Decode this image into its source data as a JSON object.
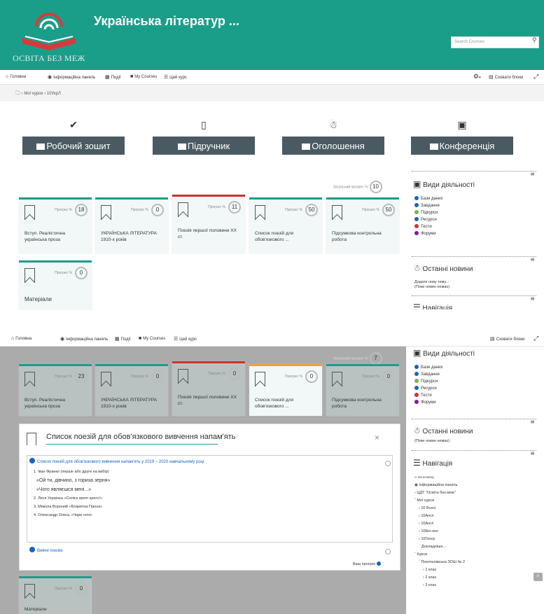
{
  "header": {
    "logo_text": "ОСВІТА БЕЗ МЕЖ",
    "course_title": "Українська літератур ...",
    "search_placeholder": "Search Courses",
    "search_icon": "search-icon"
  },
  "nav": {
    "items": [
      "Головна",
      "Інформаційна панель",
      "Події",
      "My Courses",
      "Цей курс"
    ],
    "hide_blocks": "Сховати блоки"
  },
  "breadcrumb": [
    "Мої курси",
    "10УкрЛ"
  ],
  "quick_buttons": [
    {
      "icon": "check-circle-icon",
      "label": "Робочий зошит"
    },
    {
      "icon": "book-icon",
      "label": "Підручник"
    },
    {
      "icon": "bullhorn-icon",
      "label": "Оголошення"
    },
    {
      "icon": "desktop-icon",
      "label": "Конференція"
    }
  ],
  "progress_label": "Прогрес %",
  "total_progress_label": "Загальний прогрес %",
  "top": {
    "total_progress": "10",
    "cards": [
      {
        "name": "Вступ. Реалістична українська проза",
        "progress": "18"
      },
      {
        "name": "УКРАЇНСЬКА ЛІТЕРАТУРА 1910-х років",
        "progress": "0"
      },
      {
        "name": "Поезія першої половини ХХ ст.",
        "progress": "11"
      },
      {
        "name": "Список поезій для обов'язкового ...",
        "progress": "50"
      },
      {
        "name": "Підсумкова контрольна робота",
        "progress": "50"
      },
      {
        "name": "Матеріали",
        "progress": "0"
      }
    ]
  },
  "bottom": {
    "total_progress": "7",
    "cards": [
      {
        "name": "Вступ. Реалістична українська проза",
        "progress": "23"
      },
      {
        "name": "УКРАЇНСЬКА ЛІТЕРАТУРА 1910-х років",
        "progress": "0"
      },
      {
        "name": "Поезія першої половини ХХ ст.",
        "progress": "0"
      },
      {
        "name": "Список поезій для обов'язкового ...",
        "progress": "0"
      },
      {
        "name": "Підсумкова контрольна робота",
        "progress": "0"
      },
      {
        "name": "Матеріали",
        "progress": "0"
      }
    ]
  },
  "activities": {
    "title": "Види діяльності",
    "items": [
      {
        "label": "Бази даних",
        "color": "#1565c0"
      },
      {
        "label": "Завдання",
        "color": "#1565c0"
      },
      {
        "label": "Підкурси",
        "color": "#7cb342"
      },
      {
        "label": "Ресурси",
        "color": "#1565c0"
      },
      {
        "label": "Тести",
        "color": "#d32f2f"
      },
      {
        "label": "Форуми",
        "color": "#7b1fa2"
      }
    ]
  },
  "news": {
    "title": "Останні новини",
    "add_topic": "Додати нову тему...",
    "empty": "(Поки новин немає)"
  },
  "navigation": {
    "title": "Навігація",
    "items": [
      "На початку",
      "Інформаційна панель",
      "ЦДТ \"Освіта без меж\"",
      "Мої курси",
      "10 Всесі",
      "10Англ",
      "10Англ",
      "10Біо-еко",
      "10Геогр",
      "Докладніше...",
      "Курси",
      "Покотилівська ЗОШ № 2",
      "1 клас",
      "2 клас",
      "3 клас"
    ]
  },
  "modal": {
    "title": "Список поезій для обов'язкового вивчення напам'ять",
    "close": "×",
    "resource_link": "Список поезій для обов'язкового вивчення напам'ять у 2019 – 2020 навчальному році",
    "list": [
      "1.   Іван Франко (перше або друге на вибір)",
      "«Ой ти, дівчино, з гориха зерня»",
      "«Чого являєшся мені...»",
      "2.   Леся Українка  «Contra spem spero!»",
      "3.   Микола Вороний «Блакитна Панна»",
      "4.   Олександр Олесь «Чари ночі»"
    ],
    "assignment": "Вивчи поезію",
    "your_progress": "Ваш прогрес"
  }
}
